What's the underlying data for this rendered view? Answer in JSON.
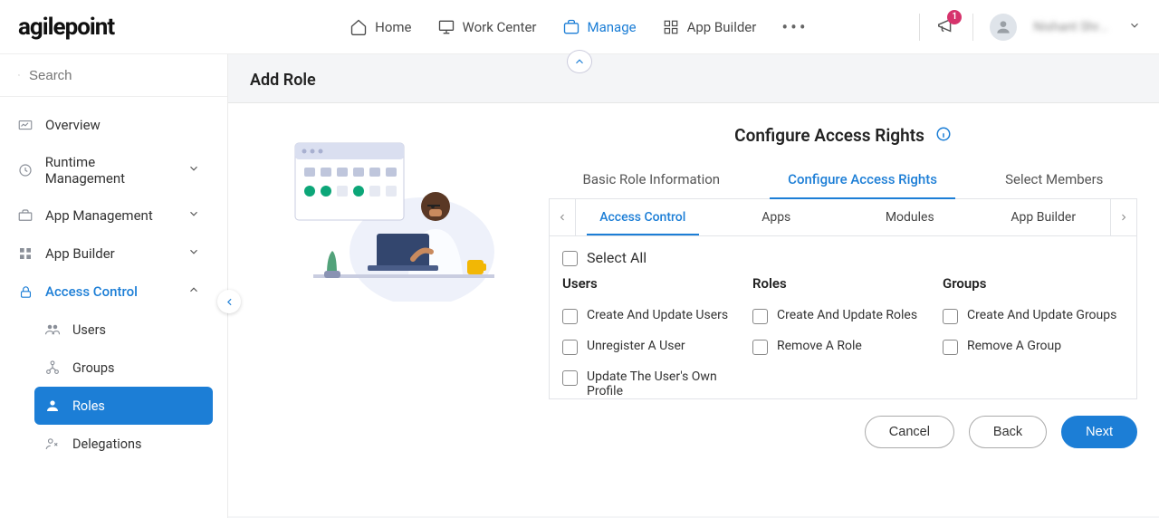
{
  "header": {
    "logo_text": "agilepoint",
    "nav": [
      {
        "icon": "home",
        "label": "Home"
      },
      {
        "icon": "monitor",
        "label": "Work Center"
      },
      {
        "icon": "briefcase",
        "label": "Manage",
        "active": true
      },
      {
        "icon": "grid",
        "label": "App Builder"
      }
    ],
    "notif_count": "1",
    "user_name": "Nishant Shr..."
  },
  "sidebar": {
    "search_placeholder": "Search",
    "items": [
      {
        "icon": "chart",
        "label": "Overview"
      },
      {
        "icon": "clock",
        "label": "Runtime Management",
        "expandable": true,
        "expanded": false
      },
      {
        "icon": "briefcase",
        "label": "App Management",
        "expandable": true,
        "expanded": false
      },
      {
        "icon": "grid",
        "label": "App Builder",
        "expandable": true,
        "expanded": false
      },
      {
        "icon": "lock",
        "label": "Access Control",
        "expandable": true,
        "expanded": true,
        "active": true,
        "children": [
          {
            "icon": "users",
            "label": "Users"
          },
          {
            "icon": "tree",
            "label": "Groups"
          },
          {
            "icon": "person",
            "label": "Roles",
            "selected": true
          },
          {
            "icon": "delegate",
            "label": "Delegations"
          }
        ]
      }
    ]
  },
  "content": {
    "page_title": "Add Role",
    "section_title": "Configure Access Rights",
    "steps": [
      {
        "label": "Basic Role Information"
      },
      {
        "label": "Configure Access Rights",
        "active": true
      },
      {
        "label": "Select Members"
      }
    ],
    "subtabs": [
      {
        "label": "Access Control",
        "active": true
      },
      {
        "label": "Apps"
      },
      {
        "label": "Modules"
      },
      {
        "label": "App Builder"
      }
    ],
    "select_all_label": "Select All",
    "columns": [
      {
        "heading": "Users",
        "items": [
          "Create And Update Users",
          "Unregister A User",
          "Update The User's Own Profile"
        ]
      },
      {
        "heading": "Roles",
        "items": [
          "Create And Update Roles",
          "Remove A Role"
        ]
      },
      {
        "heading": "Groups",
        "items": [
          "Create And Update Groups",
          "Remove A Group"
        ]
      }
    ],
    "buttons": {
      "cancel": "Cancel",
      "back": "Back",
      "next": "Next"
    }
  }
}
